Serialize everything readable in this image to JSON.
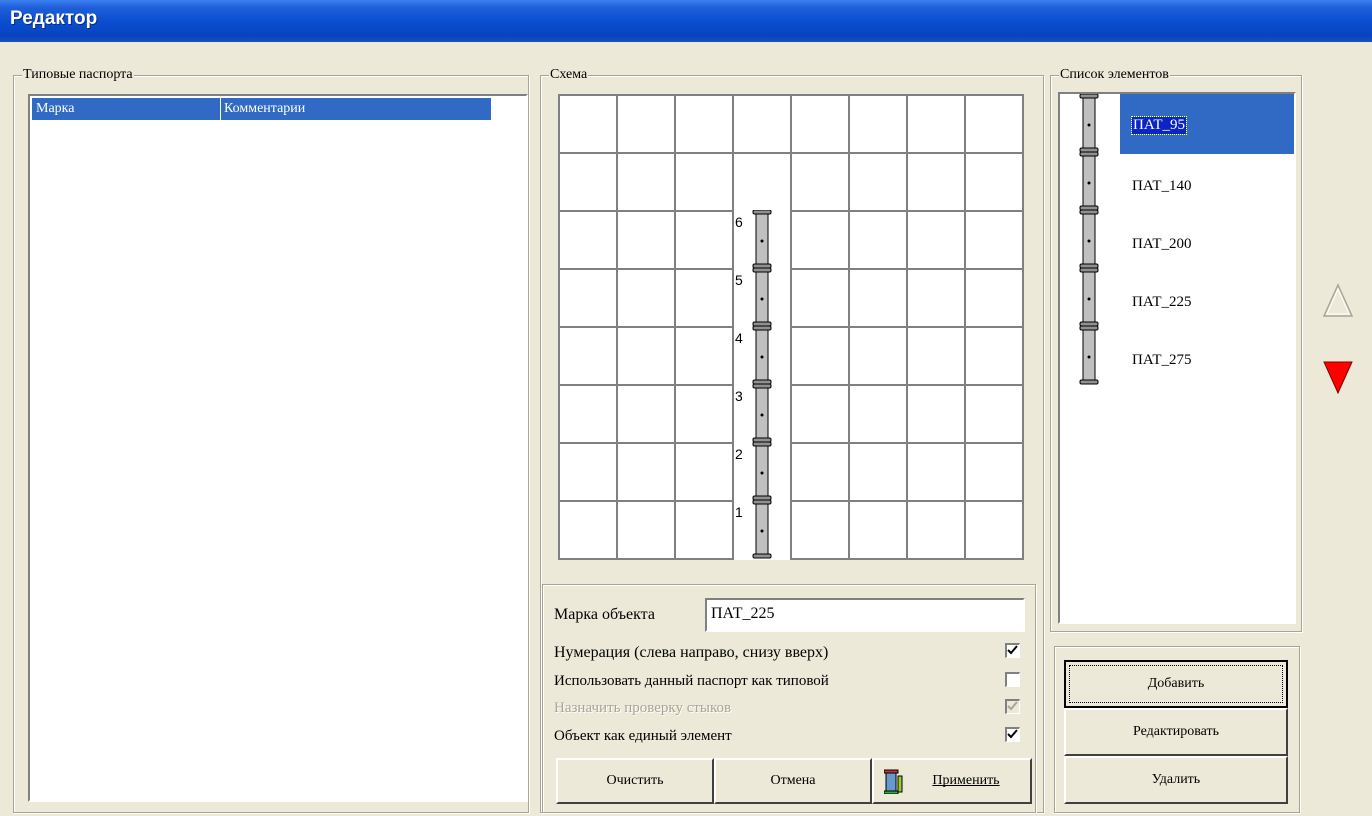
{
  "window": {
    "title": "Редактор"
  },
  "passports": {
    "group_label": "Типовые паспорта",
    "columns": [
      "Марка",
      "Комментарии"
    ],
    "rows": []
  },
  "scheme": {
    "group_label": "Схема",
    "grid": {
      "cols": 8,
      "rows": 8
    },
    "element_numbers": [
      "6",
      "5",
      "4",
      "3",
      "2",
      "1"
    ],
    "object_mark_label": "Марка объекта",
    "object_mark_value": "ПАТ_225",
    "options": [
      {
        "label": "Нумерация (слева направо, снизу вверх)",
        "checked": true,
        "enabled": true
      },
      {
        "label": "Использовать данный паспорт как типовой",
        "checked": false,
        "enabled": true
      },
      {
        "label": "Назначить проверку стыков",
        "checked": true,
        "enabled": false
      },
      {
        "label": "Объект как единый элемент",
        "checked": true,
        "enabled": true
      }
    ],
    "buttons": {
      "clear": "Очистить",
      "cancel": "Отмена",
      "apply": "Применить"
    }
  },
  "elements": {
    "group_label": "Список элементов",
    "items": [
      "ПАТ_95",
      "ПАТ_140",
      "ПАТ_200",
      "ПАТ_225",
      "ПАТ_275"
    ],
    "selected_index": 0,
    "buttons": {
      "add": "Добавить",
      "edit": "Редактировать",
      "delete": "Удалить"
    }
  },
  "colors": {
    "selection": "#316ac5",
    "arrow_down": "#ff0000"
  }
}
